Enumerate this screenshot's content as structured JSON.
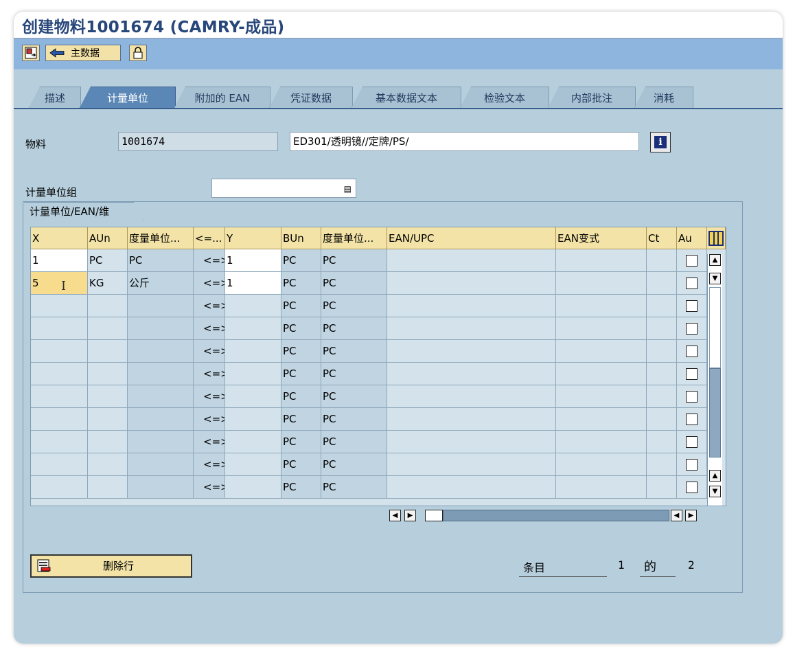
{
  "window": {
    "title": "创建物料1001674 (CAMRY-成品)"
  },
  "toolbar": {
    "main_data_label": "主数据"
  },
  "tabs": [
    {
      "label": "描述",
      "active": false
    },
    {
      "label": "计量单位",
      "active": true
    },
    {
      "label": "附加的 EAN",
      "active": false
    },
    {
      "label": "凭证数据",
      "active": false
    },
    {
      "label": "基本数据文本",
      "active": false
    },
    {
      "label": "检验文本",
      "active": false
    },
    {
      "label": "内部批注",
      "active": false
    },
    {
      "label": "消耗",
      "active": false
    }
  ],
  "header": {
    "material_label": "物料",
    "material_number": "1001674",
    "material_desc": "ED301/透明镜//定牌/PS/",
    "uom_group_label": "计量单位组",
    "uom_group_value": ""
  },
  "table": {
    "group_title": "计量单位/EAN/维",
    "columns": [
      "X",
      "AUn",
      "度量单位...",
      "<=...",
      "Y",
      "BUn",
      "度量单位...",
      "EAN/UPC",
      "EAN变式",
      "Ct",
      "Au"
    ],
    "rows": [
      {
        "x": "1",
        "aun": "PC",
        "uom_text": "PC",
        "op": "<=>",
        "y": "1",
        "bun": "PC",
        "bun_text": "PC",
        "ean": "",
        "ean_cat": "",
        "ct": "",
        "au": false
      },
      {
        "x": "5",
        "aun": "KG",
        "uom_text": "公斤",
        "op": "<=>",
        "y": "1",
        "bun": "PC",
        "bun_text": "PC",
        "ean": "",
        "ean_cat": "",
        "ct": "",
        "au": false
      },
      {
        "x": "",
        "aun": "",
        "uom_text": "",
        "op": "<=>",
        "y": "",
        "bun": "PC",
        "bun_text": "PC",
        "ean": "",
        "ean_cat": "",
        "ct": "",
        "au": false
      },
      {
        "x": "",
        "aun": "",
        "uom_text": "",
        "op": "<=>",
        "y": "",
        "bun": "PC",
        "bun_text": "PC",
        "ean": "",
        "ean_cat": "",
        "ct": "",
        "au": false
      },
      {
        "x": "",
        "aun": "",
        "uom_text": "",
        "op": "<=>",
        "y": "",
        "bun": "PC",
        "bun_text": "PC",
        "ean": "",
        "ean_cat": "",
        "ct": "",
        "au": false
      },
      {
        "x": "",
        "aun": "",
        "uom_text": "",
        "op": "<=>",
        "y": "",
        "bun": "PC",
        "bun_text": "PC",
        "ean": "",
        "ean_cat": "",
        "ct": "",
        "au": false
      },
      {
        "x": "",
        "aun": "",
        "uom_text": "",
        "op": "<=>",
        "y": "",
        "bun": "PC",
        "bun_text": "PC",
        "ean": "",
        "ean_cat": "",
        "ct": "",
        "au": false
      },
      {
        "x": "",
        "aun": "",
        "uom_text": "",
        "op": "<=>",
        "y": "",
        "bun": "PC",
        "bun_text": "PC",
        "ean": "",
        "ean_cat": "",
        "ct": "",
        "au": false
      },
      {
        "x": "",
        "aun": "",
        "uom_text": "",
        "op": "<=>",
        "y": "",
        "bun": "PC",
        "bun_text": "PC",
        "ean": "",
        "ean_cat": "",
        "ct": "",
        "au": false
      },
      {
        "x": "",
        "aun": "",
        "uom_text": "",
        "op": "<=>",
        "y": "",
        "bun": "PC",
        "bun_text": "PC",
        "ean": "",
        "ean_cat": "",
        "ct": "",
        "au": false
      },
      {
        "x": "",
        "aun": "",
        "uom_text": "",
        "op": "<=>",
        "y": "",
        "bun": "PC",
        "bun_text": "PC",
        "ean": "",
        "ean_cat": "",
        "ct": "",
        "au": false
      }
    ]
  },
  "footer": {
    "delete_row_label": "删除行",
    "entry_label": "条目",
    "entry_current": "1",
    "entry_of": "的",
    "entry_total": "2"
  },
  "colors": {
    "toolbar": "#8eb5de",
    "header_cell": "#f3e3a7",
    "active_tab": "#5b87b6",
    "title": "#27477a"
  }
}
